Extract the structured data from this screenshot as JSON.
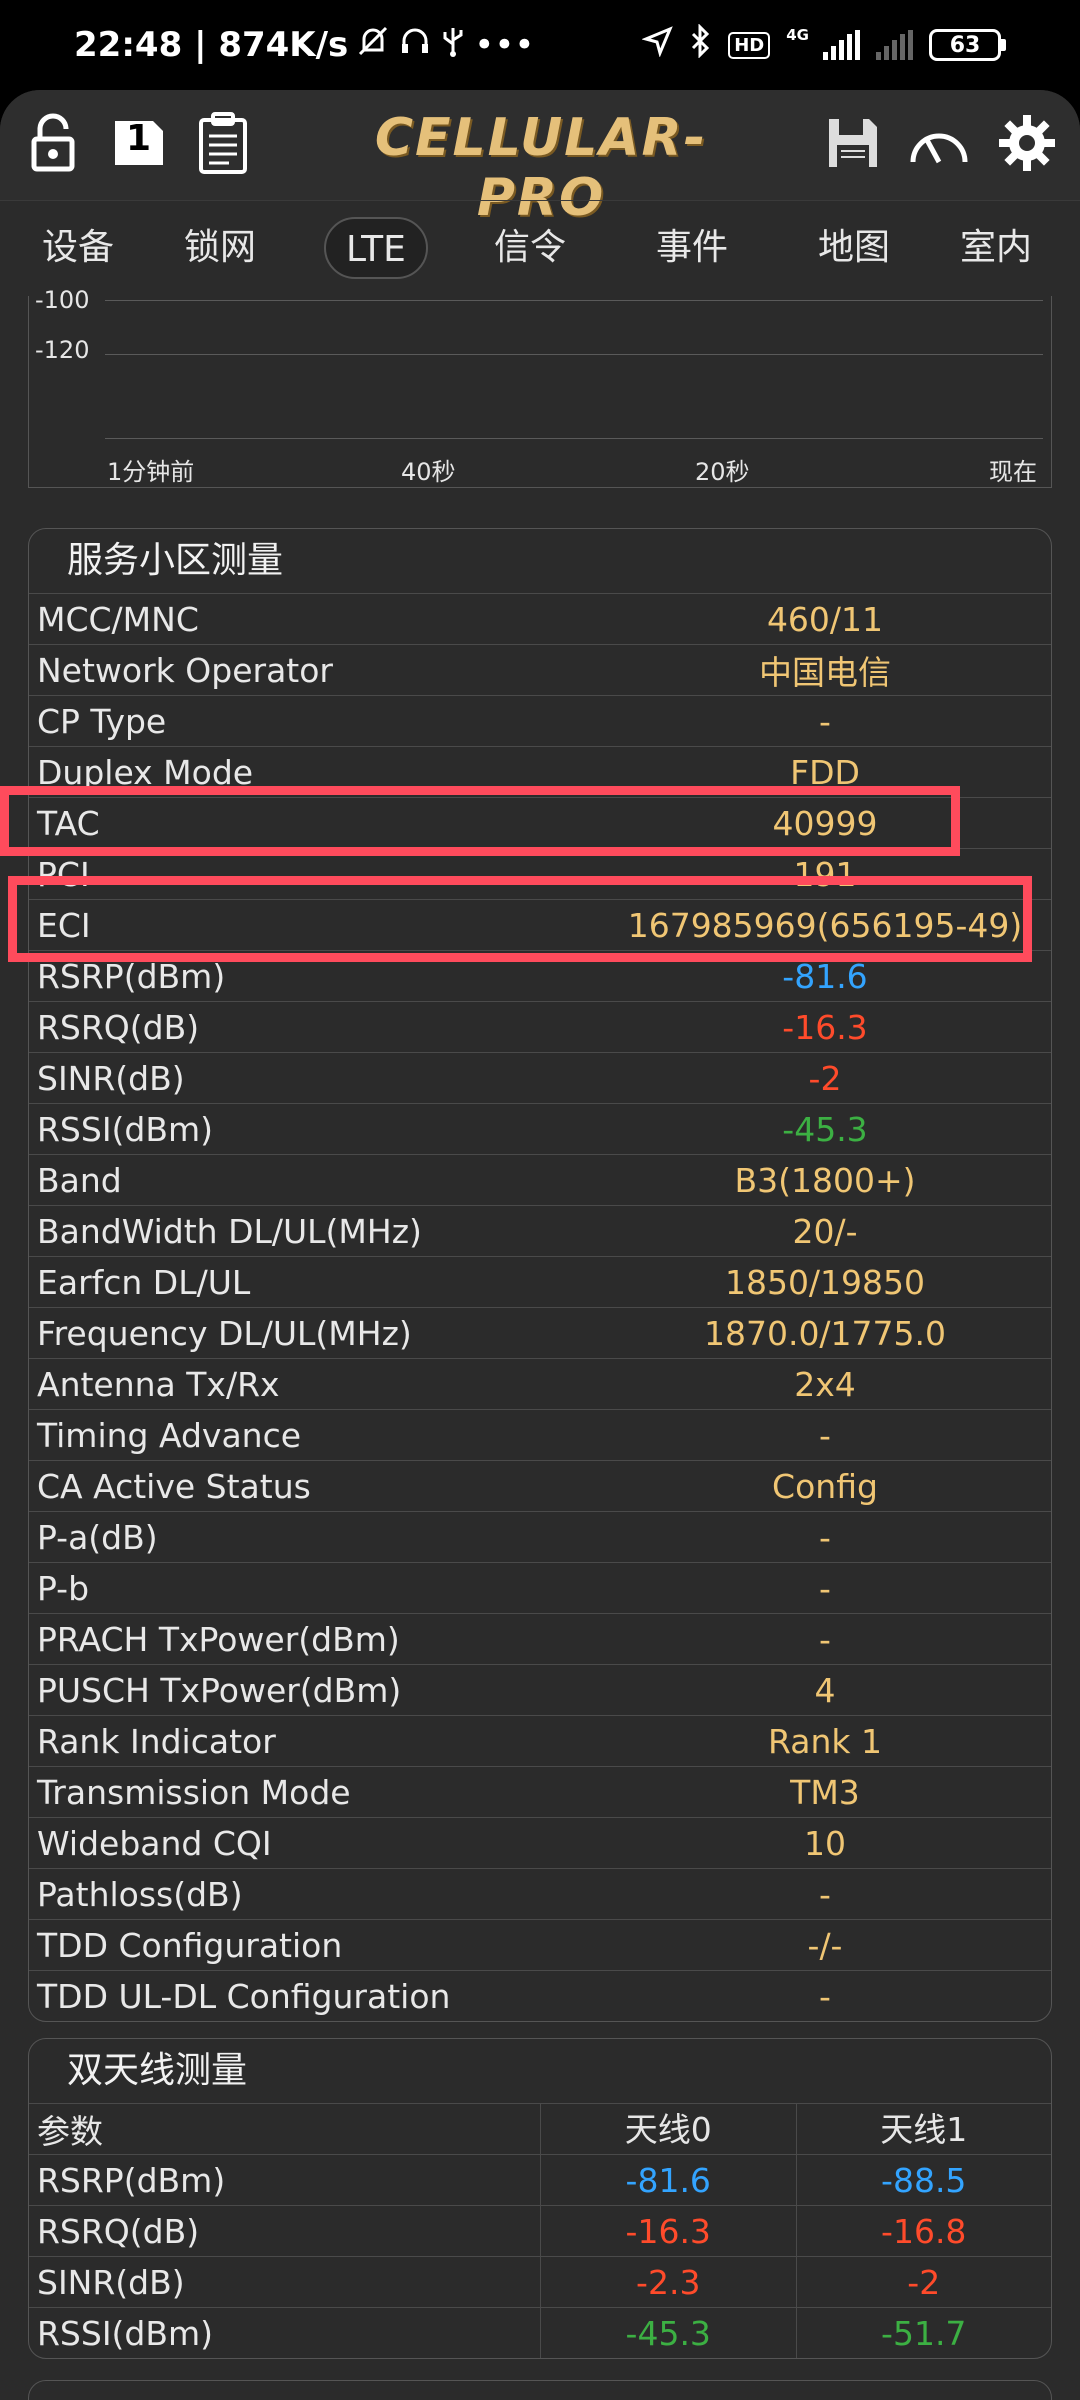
{
  "status_bar": {
    "time_speed": "22:48 | 874K/s",
    "network_label": "4G",
    "hd_label": "HD",
    "battery": "63"
  },
  "app": {
    "title": "CELLULAR-PRO",
    "sim_slot": "1"
  },
  "tabs": [
    "设备",
    "锁网",
    "LTE",
    "信令",
    "事件",
    "地图",
    "室内"
  ],
  "active_tab": "LTE",
  "chart": {
    "y_labels": [
      "-100",
      "-120"
    ],
    "x_labels": [
      "1分钟前",
      "40秒",
      "20秒",
      "现在"
    ]
  },
  "serving_cell": {
    "title": "服务小区测量",
    "rows": [
      {
        "key": "MCC/MNC",
        "value": "460/11"
      },
      {
        "key": "Network Operator",
        "value": "中国电信"
      },
      {
        "key": "CP Type",
        "value": "-"
      },
      {
        "key": "Duplex Mode",
        "value": "FDD"
      },
      {
        "key": "TAC",
        "value": "40999"
      },
      {
        "key": "PCI",
        "value": "191"
      },
      {
        "key": "ECI",
        "value": "167985969(656195-49)"
      },
      {
        "key": "RSRP(dBm)",
        "value": "-81.6",
        "color": "blue"
      },
      {
        "key": "RSRQ(dB)",
        "value": "-16.3",
        "color": "red"
      },
      {
        "key": "SINR(dB)",
        "value": "-2",
        "color": "red"
      },
      {
        "key": "RSSI(dBm)",
        "value": "-45.3",
        "color": "green"
      },
      {
        "key": "Band",
        "value": "B3(1800+)"
      },
      {
        "key": "BandWidth DL/UL(MHz)",
        "value": "20/-"
      },
      {
        "key": "Earfcn DL/UL",
        "value": "1850/19850"
      },
      {
        "key": "Frequency DL/UL(MHz)",
        "value": "1870.0/1775.0"
      },
      {
        "key": "Antenna Tx/Rx",
        "value": "2x4"
      },
      {
        "key": "Timing Advance",
        "value": "-"
      },
      {
        "key": "CA Active Status",
        "value": "Config"
      },
      {
        "key": "P-a(dB)",
        "value": "-"
      },
      {
        "key": "P-b",
        "value": "-"
      },
      {
        "key": "PRACH TxPower(dBm)",
        "value": "-"
      },
      {
        "key": "PUSCH TxPower(dBm)",
        "value": "4"
      },
      {
        "key": "Rank Indicator",
        "value": "Rank 1"
      },
      {
        "key": "Transmission Mode",
        "value": "TM3"
      },
      {
        "key": "Wideband CQI",
        "value": "10"
      },
      {
        "key": "Pathloss(dB)",
        "value": "-"
      },
      {
        "key": "TDD Configuration",
        "value": "-/-"
      },
      {
        "key": "TDD UL-DL Configuration",
        "value": "-"
      }
    ]
  },
  "dual_antenna": {
    "title": "双天线测量",
    "headers": [
      "参数",
      "天线0",
      "天线1"
    ],
    "rows": [
      {
        "param": "RSRP(dBm)",
        "a0": "-81.6",
        "a1": "-88.5",
        "color": "blue"
      },
      {
        "param": "RSRQ(dB)",
        "a0": "-16.3",
        "a1": "-16.8",
        "color": "red"
      },
      {
        "param": "SINR(dB)",
        "a0": "-2.3",
        "a1": "-2",
        "color": "red"
      },
      {
        "param": "RSSI(dBm)",
        "a0": "-45.3",
        "a1": "-51.7",
        "color": "green"
      }
    ]
  },
  "colors": {
    "accent_gold": "#f0c674",
    "blue": "#33a4ff",
    "red": "#ff4b2b",
    "green": "#3cb043",
    "highlight": "#ff4b5c"
  }
}
